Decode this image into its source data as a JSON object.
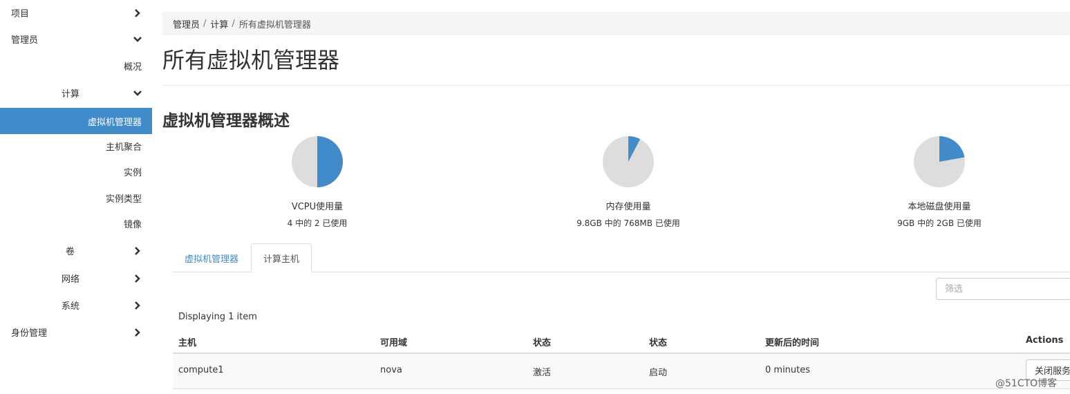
{
  "sidebar": {
    "project": "项目",
    "admin": "管理员",
    "overview": "概况",
    "compute": "计算",
    "hypervisors": "虚拟机管理器",
    "host_aggregates": "主机聚合",
    "instances": "实例",
    "flavors": "实例类型",
    "images": "镜像",
    "volumes": "卷",
    "network": "网络",
    "system": "系统",
    "identity": "身份管理"
  },
  "breadcrumb": {
    "admin": "管理员",
    "compute": "计算",
    "current": "所有虚拟机管理器",
    "separator": "/"
  },
  "page_title": "所有虚拟机管理器",
  "summary": {
    "title": "虚拟机管理器概述",
    "pies": [
      {
        "label": "VCPU使用量",
        "sub": "4 中的 2 已使用",
        "fraction": 0.5
      },
      {
        "label": "内存使用量",
        "sub": "9.8GB 中的 768MB 已使用",
        "fraction": 0.0765
      },
      {
        "label": "本地磁盘使用量",
        "sub": "9GB 中的 2GB 已使用",
        "fraction": 0.222
      }
    ]
  },
  "tabs": {
    "hypervisor": "虚拟机管理器",
    "compute_host": "计算主机"
  },
  "filter": {
    "placeholder": "筛选"
  },
  "table": {
    "count": "Displaying 1 item",
    "headers": {
      "host": "主机",
      "zone": "可用域",
      "status": "状态",
      "state": "状态",
      "updated": "更新后的时间",
      "actions": "Actions"
    },
    "rows": [
      {
        "host": "compute1",
        "zone": "nova",
        "status": "激活",
        "state": "启动",
        "updated": "0 minutes",
        "action": "关闭服务"
      }
    ]
  },
  "colors": {
    "accent": "#428bca",
    "pie_used": "#428bca",
    "pie_free": "#dddddd"
  },
  "watermark": "@51CTO博客"
}
